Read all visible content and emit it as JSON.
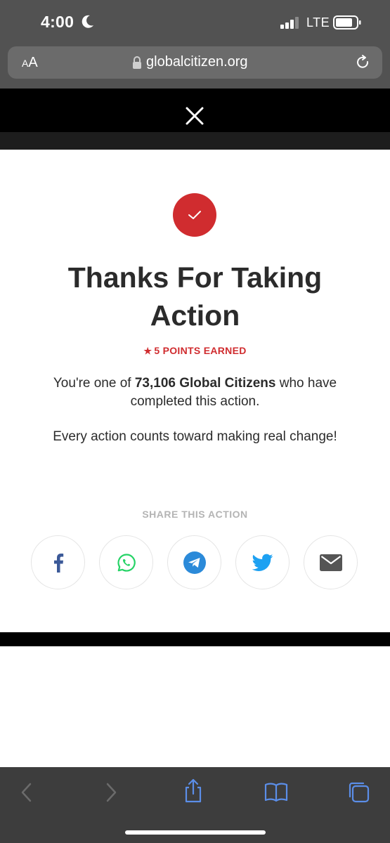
{
  "status_bar": {
    "time": "4:00",
    "network": "LTE"
  },
  "browser": {
    "text_size_label_small": "A",
    "text_size_label_large": "A",
    "url": "globalcitizen.org"
  },
  "modal": {
    "title": "Thanks For Taking Action",
    "points": "5 POINTS EARNED",
    "description_prefix": "You're one of ",
    "description_count": "73,106 Global Citizens",
    "description_suffix": " who have completed this action.",
    "encouragement": "Every action counts toward making real change!",
    "share_label": "SHARE THIS ACTION",
    "share_buttons": [
      "facebook-icon",
      "whatsapp-icon",
      "telegram-icon",
      "twitter-icon",
      "email-icon"
    ]
  },
  "colors": {
    "accent": "#d02c2f",
    "facebook": "#3b5998",
    "whatsapp": "#25d366",
    "telegram": "#2b8ad9",
    "twitter": "#1da1f2",
    "email": "#555555",
    "toolbar_icon": "#5b8ee8"
  }
}
